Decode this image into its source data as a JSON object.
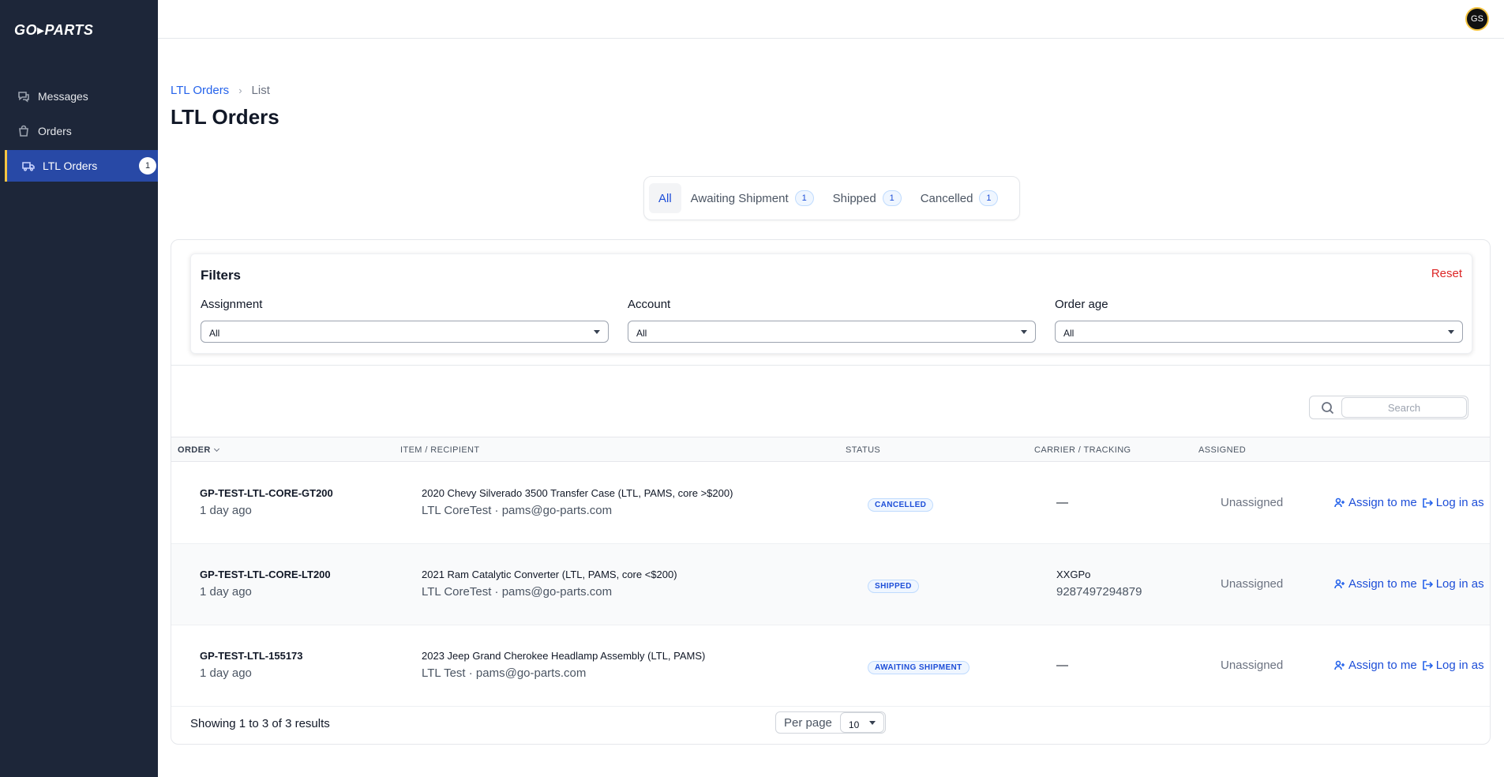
{
  "app": {
    "logo_text": "GO▸PARTS"
  },
  "sidebar": {
    "items": [
      {
        "label": "Messages",
        "icon": "chat-icon"
      },
      {
        "label": "Orders",
        "icon": "shopping-bag-icon"
      },
      {
        "label": "LTL Orders",
        "icon": "truck-icon",
        "badge": "1",
        "active": true
      }
    ]
  },
  "topbar": {
    "avatar_initials": "GS"
  },
  "breadcrumb": {
    "parent": "LTL Orders",
    "current": "List"
  },
  "page": {
    "title": "LTL Orders"
  },
  "tabs": [
    {
      "label": "All",
      "active": true
    },
    {
      "label": "Awaiting Shipment",
      "count": "1"
    },
    {
      "label": "Shipped",
      "count": "1"
    },
    {
      "label": "Cancelled",
      "count": "1"
    }
  ],
  "filters": {
    "title": "Filters",
    "reset_label": "Reset",
    "assignment": {
      "label": "Assignment",
      "value": "All"
    },
    "account": {
      "label": "Account",
      "value": "All"
    },
    "order_age": {
      "label": "Order age",
      "value": "All"
    }
  },
  "search": {
    "placeholder": "Search"
  },
  "table": {
    "headers": {
      "order": "Order",
      "item_recipient": "Item / Recipient",
      "status": "Status",
      "carrier_tracking": "Carrier / Tracking",
      "assigned": "Assigned"
    },
    "rows": [
      {
        "order_id": "GP-TEST-LTL-CORE-GT200",
        "age": "1 day ago",
        "item": "2020 Chevy Silverado 3500 Transfer Case (LTL, PAMS, core >$200)",
        "recipient": "LTL CoreTest · pams@go-parts.com",
        "status": "CANCELLED",
        "carrier": "—",
        "tracking": "",
        "assigned": "Unassigned",
        "assign_label": "Assign to me",
        "login_label": "Log in as"
      },
      {
        "order_id": "GP-TEST-LTL-CORE-LT200",
        "age": "1 day ago",
        "item": "2021 Ram Catalytic Converter (LTL, PAMS, core <$200)",
        "recipient": "LTL CoreTest · pams@go-parts.com",
        "status": "SHIPPED",
        "carrier": "XXGPo",
        "tracking": "9287497294879",
        "assigned": "Unassigned",
        "assign_label": "Assign to me",
        "login_label": "Log in as"
      },
      {
        "order_id": "GP-TEST-LTL-155173",
        "age": "1 day ago",
        "item": "2023 Jeep Grand Cherokee Headlamp Assembly (LTL, PAMS)",
        "recipient": "LTL Test · pams@go-parts.com",
        "status": "AWAITING SHIPMENT",
        "carrier": "—",
        "tracking": "",
        "assigned": "Unassigned",
        "assign_label": "Assign to me",
        "login_label": "Log in as"
      }
    ]
  },
  "footer": {
    "showing": "Showing 1 to 3 of 3 results",
    "per_page_label": "Per page",
    "per_page_value": "10"
  }
}
